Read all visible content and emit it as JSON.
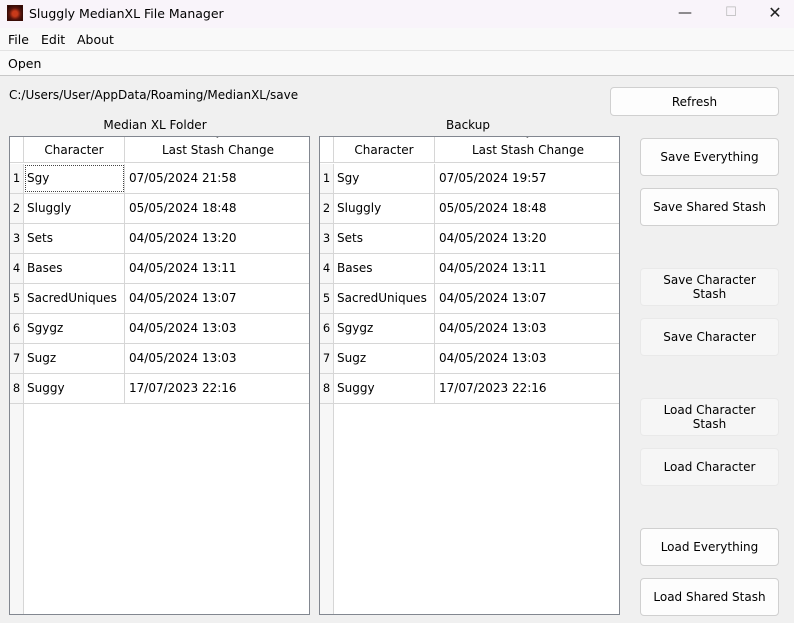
{
  "window": {
    "title": "Sluggly MedianXL File Manager",
    "controls": {
      "minimize": "—",
      "maximize": "☐",
      "close": "✕"
    }
  },
  "menu": {
    "file": "File",
    "edit": "Edit",
    "about": "About"
  },
  "toolbar": {
    "open": "Open"
  },
  "path": "C:/Users/User/AppData/Roaming/MedianXL/save",
  "buttons": {
    "refresh": "Refresh",
    "save_everything": "Save Everything",
    "save_shared_stash": "Save Shared Stash",
    "save_character_stash": "Save Character Stash",
    "save_character": "Save Character",
    "load_character_stash": "Load Character Stash",
    "load_character": "Load Character",
    "load_everything": "Load Everything",
    "load_shared_stash": "Load Shared Stash"
  },
  "median_table": {
    "title": "Median XL Folder",
    "columns": [
      "Character",
      "Last Stash Change"
    ],
    "sort_indicator": "⌄",
    "rows": [
      {
        "num": "1",
        "character": "Sgy",
        "date": "07/05/2024 21:58"
      },
      {
        "num": "2",
        "character": "Sluggly",
        "date": "05/05/2024 18:48"
      },
      {
        "num": "3",
        "character": "Sets",
        "date": "04/05/2024 13:20"
      },
      {
        "num": "4",
        "character": "Bases",
        "date": "04/05/2024 13:11"
      },
      {
        "num": "5",
        "character": "SacredUniques",
        "date": "04/05/2024 13:07"
      },
      {
        "num": "6",
        "character": "Sgygz",
        "date": "04/05/2024 13:03"
      },
      {
        "num": "7",
        "character": "Sugz",
        "date": "04/05/2024 13:03"
      },
      {
        "num": "8",
        "character": "Suggy",
        "date": "17/07/2023 22:16"
      }
    ]
  },
  "backup_table": {
    "title": "Backup",
    "columns": [
      "Character",
      "Last Stash Change"
    ],
    "sort_indicator": "⌄",
    "rows": [
      {
        "num": "1",
        "character": "Sgy",
        "date": "07/05/2024 19:57"
      },
      {
        "num": "2",
        "character": "Sluggly",
        "date": "05/05/2024 18:48"
      },
      {
        "num": "3",
        "character": "Sets",
        "date": "04/05/2024 13:20"
      },
      {
        "num": "4",
        "character": "Bases",
        "date": "04/05/2024 13:11"
      },
      {
        "num": "5",
        "character": "SacredUniques",
        "date": "04/05/2024 13:07"
      },
      {
        "num": "6",
        "character": "Sgygz",
        "date": "04/05/2024 13:03"
      },
      {
        "num": "7",
        "character": "Sugz",
        "date": "04/05/2024 13:03"
      },
      {
        "num": "8",
        "character": "Suggy",
        "date": "17/07/2023 22:16"
      }
    ]
  }
}
